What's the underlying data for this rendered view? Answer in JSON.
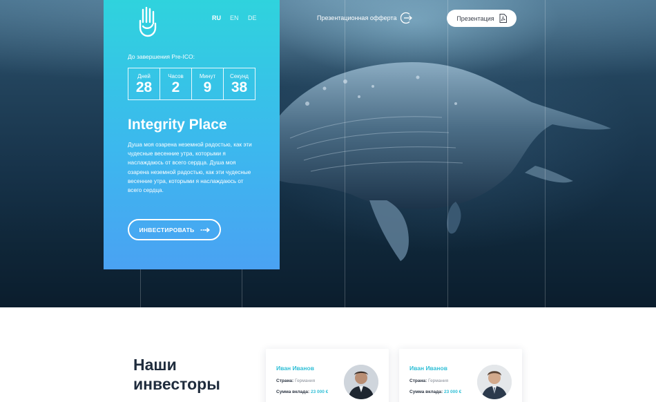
{
  "nav": {
    "languages": [
      {
        "code": "RU",
        "active": true
      },
      {
        "code": "EN",
        "active": false
      },
      {
        "code": "DE",
        "active": false
      }
    ],
    "offer_label": "Презентационная офферта",
    "presentation_label": "Презентация"
  },
  "countdown": {
    "label": "До завершения Pre-ICO:",
    "cells": [
      {
        "unit": "Дней",
        "value": "28"
      },
      {
        "unit": "Часов",
        "value": "2"
      },
      {
        "unit": "Минут",
        "value": "9"
      },
      {
        "unit": "Секунд",
        "value": "38"
      }
    ]
  },
  "hero": {
    "title": "Integrity Place",
    "text": "Душа моя озарена неземной радостью, как эти чудесные весенние утра, которыми я наслаждаюсь от всего сердца. Душа моя озарена неземной радостью, как эти чудесные весенние утра, которыми я наслаждаюсь от всего сердца.",
    "invest_label": "ИНВЕСТИРОВАТЬ"
  },
  "investors": {
    "title_line1": "Наши",
    "title_line2": "инвесторы",
    "cards": [
      {
        "name": "Иван Иванов",
        "country_label": "Страна:",
        "country": "Германия",
        "sum_label": "Сумма вклада:",
        "sum": "23 000 €"
      },
      {
        "name": "Иван Иванов",
        "country_label": "Страна:",
        "country": "Германия",
        "sum_label": "Сумма вклада:",
        "sum": "23 000 €"
      }
    ]
  },
  "colors": {
    "card_gradient_top": "#2fd3dd",
    "card_gradient_bottom": "#4aa2f3",
    "accent": "#2fbfd6",
    "dark_text": "#1f2c3d"
  },
  "icons": [
    "hand-logo-icon",
    "arrow-circle-icon",
    "pdf-icon",
    "arrow-right-icon"
  ]
}
